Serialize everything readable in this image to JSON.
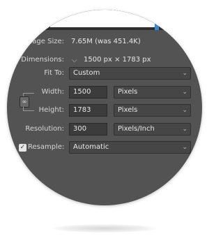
{
  "dialog": {
    "image_size": {
      "label": "Image Size:",
      "value": "7.65M (was 451.4K)"
    },
    "dimensions": {
      "label": "Dimensions:",
      "value": "1500 px  ×  1783 px"
    },
    "fit_to": {
      "label": "Fit To:",
      "value": "Custom"
    },
    "width": {
      "label": "Width:",
      "value": "1500",
      "unit": "Pixels"
    },
    "height": {
      "label": "Height:",
      "value": "1783",
      "unit": "Pixels"
    },
    "resolution": {
      "label": "Resolution:",
      "value": "300",
      "unit": "Pixels/Inch"
    },
    "resample": {
      "label": "Resample:",
      "checked": true,
      "value": "Automatic"
    }
  },
  "icons": {
    "constrain": "chain-link-icon",
    "dimensions_toggle": "chevron-down-icon",
    "select_caret": "chevron-down-icon",
    "checkbox": "checkmark-icon"
  },
  "colors": {
    "panel_bg": "#535353",
    "field_bg": "#3c3c3c",
    "text": "#d6d6d6",
    "accent": "#3e87d4"
  }
}
